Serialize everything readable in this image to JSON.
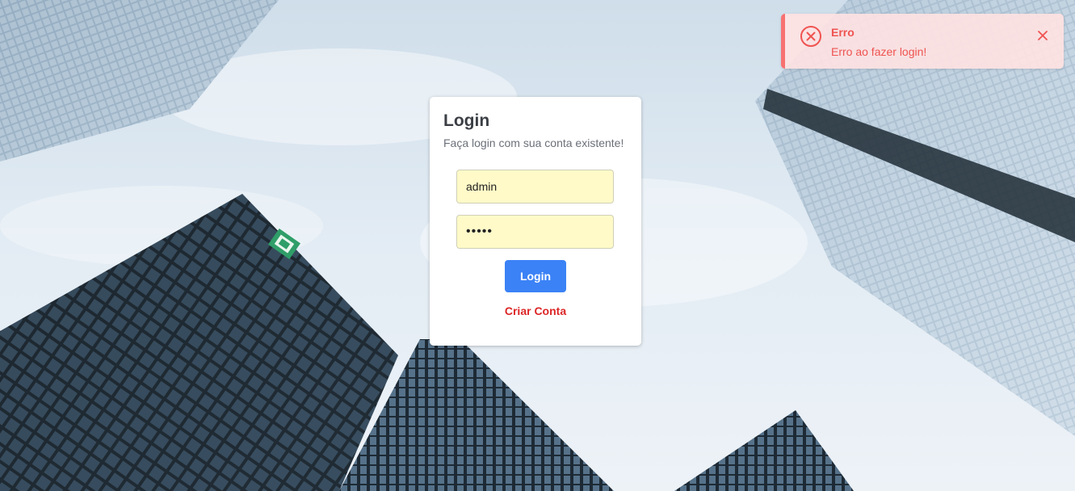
{
  "login": {
    "title": "Login",
    "subtitle": "Faça login com sua conta existente!",
    "username_value": "admin",
    "password_value": "admin",
    "login_button_label": "Login",
    "create_account_label": "Criar Conta"
  },
  "toast": {
    "title": "Erro",
    "message": "Erro ao fazer login!",
    "status_icon": "error-circle-x-icon",
    "close_icon": "close-icon"
  },
  "colors": {
    "primary_button": "#3b82f6",
    "link_red": "#dc2626",
    "toast_bg": "#fee2e2",
    "toast_accent": "#f87171",
    "autofill_yellow": "#fffac8"
  }
}
